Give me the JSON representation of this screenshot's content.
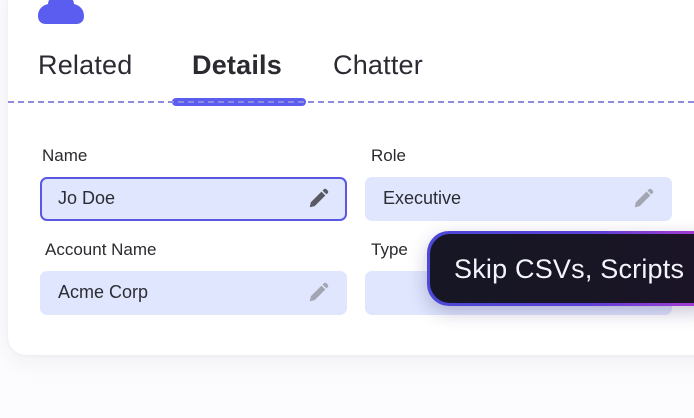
{
  "tabs": [
    {
      "label": "Related",
      "active": false
    },
    {
      "label": "Details",
      "active": true
    },
    {
      "label": "Chatter",
      "active": false
    }
  ],
  "fields": {
    "name": {
      "label": "Name",
      "value": "Jo Doe",
      "focused": true
    },
    "role": {
      "label": "Role",
      "value": "Executive"
    },
    "account_name": {
      "label": "Account Name",
      "value": "Acme Corp"
    },
    "type": {
      "label": "Type",
      "value": ""
    }
  },
  "promo": {
    "text": "Skip CSVs, Scripts"
  },
  "colors": {
    "accent": "#5b5df0",
    "field_bg": "#dfe6fd",
    "promo_bg": "#161624",
    "promo_border_start": "#4b49d6",
    "promo_border_end": "#b23ad0"
  },
  "icons": {
    "avatar": "user-avatar-icon",
    "edit": "pencil-icon"
  }
}
